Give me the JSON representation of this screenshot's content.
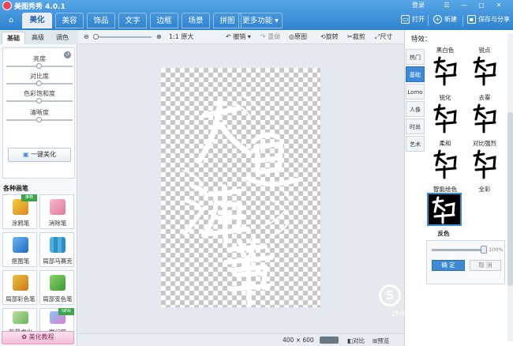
{
  "app": {
    "title": "美图秀秀 4.0.1",
    "login": "登录"
  },
  "tabs": [
    "美化",
    "美容",
    "饰品",
    "文字",
    "边框",
    "场景",
    "拼图",
    "更多功能"
  ],
  "toolbar": {
    "open": "打开",
    "new": "新建",
    "save": "保存与分享"
  },
  "left": {
    "tabs": [
      "基础",
      "高级",
      "调色"
    ],
    "adjust": [
      "亮度",
      "对比度",
      "色彩饱和度",
      "清晰度"
    ],
    "one_key": "一键美化",
    "brushes_title": "各种画笔",
    "brushes": [
      "涂鸦笔",
      "消除笔",
      "抠图笔",
      "局部马赛克",
      "局部彩色笔",
      "局部变色笔",
      "背景虚化",
      "魔幻笔"
    ],
    "badge_new": "推荐",
    "badge_new2": "NEW",
    "tutorial": "美化教程"
  },
  "edit": {
    "actual_size": "1:1 原大",
    "undo": "撤销",
    "redo": "重做",
    "original": "原图",
    "rotate": "旋转",
    "crop": "裁剪",
    "resize": "尺寸"
  },
  "artwork_text": "大鱼海棠",
  "status": {
    "size": "400 × 600",
    "compare": "对比",
    "preview": "预览"
  },
  "right": {
    "title": "特效：",
    "tabs": [
      "热门",
      "基础",
      "Lomo",
      "人像",
      "时尚",
      "艺术"
    ],
    "effects": [
      "黑白色",
      "锐点",
      "锐化",
      "去雾",
      "柔和",
      "对比强烈",
      "智能绘色",
      "全彩",
      "反色"
    ],
    "percent": "100%",
    "ok": "确 定",
    "cancel": "取 消"
  },
  "watermark": {
    "brand": "搜狗指南",
    "url": "zhinan.sogou.com"
  },
  "colors": {
    "accent": "#3c8ad6",
    "topbar": "#2f82cf"
  }
}
